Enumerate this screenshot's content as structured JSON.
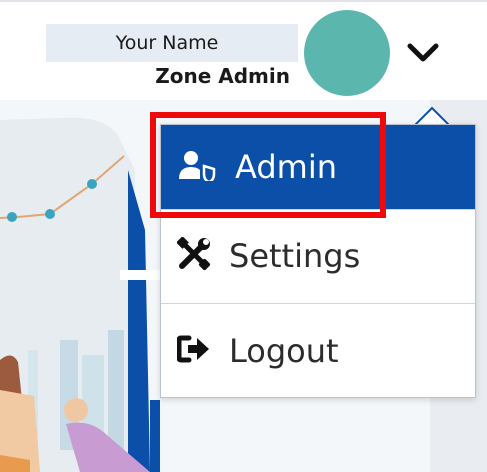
{
  "header": {
    "user_name": "Your Name",
    "user_role": "Zone Admin",
    "avatar_color": "#5bb6ae"
  },
  "menu": {
    "items": [
      {
        "label": "Admin",
        "icon": "user-shield-icon",
        "active": true
      },
      {
        "label": "Settings",
        "icon": "tools-icon",
        "active": false
      },
      {
        "label": "Logout",
        "icon": "sign-out-icon",
        "active": false
      }
    ],
    "active_color": "#0b4fa8"
  },
  "annotation": {
    "highlight_color": "#ee0a0a"
  }
}
